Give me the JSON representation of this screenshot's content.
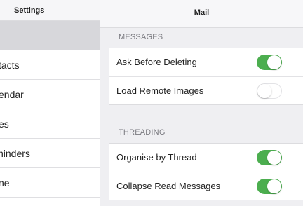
{
  "sidebar": {
    "title": "Settings",
    "items": [
      {
        "label": "tacts"
      },
      {
        "label": "endar"
      },
      {
        "label": "es"
      },
      {
        "label": "ninders"
      },
      {
        "label": "ne"
      }
    ]
  },
  "main": {
    "title": "Mail",
    "sections": [
      {
        "header": "MESSAGES",
        "rows": [
          {
            "label": "Ask Before Deleting",
            "toggle": true
          },
          {
            "label": "Load Remote Images",
            "toggle": false
          }
        ]
      },
      {
        "header": "THREADING",
        "rows": [
          {
            "label": "Organise by Thread",
            "toggle": true
          },
          {
            "label": "Collapse Read Messages",
            "toggle": true
          }
        ]
      }
    ]
  },
  "colors": {
    "toggle_on": "#4cae4f",
    "sidebar_selected": "#d7d7db"
  }
}
